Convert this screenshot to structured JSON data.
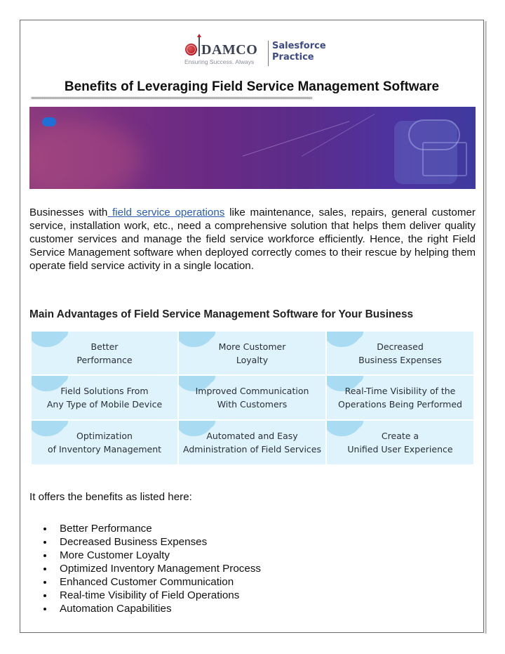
{
  "logo": {
    "brand": "DAMCO",
    "tagline": "Ensuring Success. Always",
    "practice_line1": "Salesforce",
    "practice_line2": "Practice"
  },
  "title": "Benefits of Leveraging Field Service Management Software",
  "rule": "=================================================================================================================================",
  "banner": {
    "badge_icon": "salesforce-cloud-icon"
  },
  "intro_paragraph": {
    "before_link": "Businesses with",
    "link_text": " field service operations",
    "after_link": " like maintenance, sales, repairs, general customer service, installation work, etc., need a comprehensive solution that helps them deliver quality customer services and manage the field service workforce efficiently. Hence, the right Field Service Management software when deployed correctly comes to their rescue by helping them operate field service activity in a single location."
  },
  "advantages_heading": "Main Advantages of Field Service Management Software for Your Business",
  "advantages_grid": [
    {
      "line1": "Better",
      "line2": "Performance"
    },
    {
      "line1": "More Customer",
      "line2": "Loyalty"
    },
    {
      "line1": "Decreased",
      "line2": "Business Expenses"
    },
    {
      "line1": "Field Solutions From",
      "line2": "Any Type of Mobile Device"
    },
    {
      "line1": "Improved Communication",
      "line2": "With Customers"
    },
    {
      "line1": "Real-Time Visibility of the",
      "line2": "Operations Being Performed"
    },
    {
      "line1": "Optimization",
      "line2": "of Inventory Management"
    },
    {
      "line1": "Automated and Easy",
      "line2": "Administration of Field Services"
    },
    {
      "line1": "Create a",
      "line2": "Unified User Experience"
    }
  ],
  "benefits_intro": "It offers the benefits as listed here:",
  "benefits_list": [
    "Better Performance",
    "Decreased Business Expenses",
    "More Customer Loyalty",
    "Optimized Inventory Management Process",
    "Enhanced Customer Communication",
    "Real-time Visibility of Field Operations",
    "Automation Capabilities"
  ],
  "colors": {
    "link": "#2a5db0",
    "grid_cell": "#dff3fc",
    "grid_blob": "#a9dcf3",
    "logo_text": "#3b4150",
    "practice_text": "#3d4a86",
    "banner_start": "#8b3a7e",
    "banner_end": "#3f3a9e"
  }
}
